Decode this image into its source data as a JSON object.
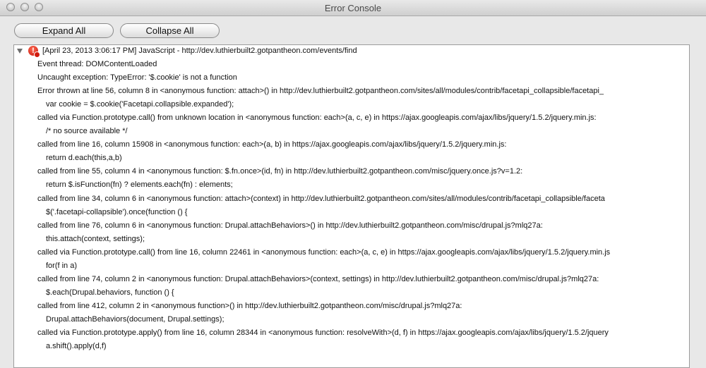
{
  "window": {
    "title": "Error Console"
  },
  "toolbar": {
    "expand_label": "Expand All",
    "collapse_label": "Collapse All"
  },
  "entry": {
    "header": "[April 23, 2013 3:06:17 PM] JavaScript - http://dev.luthierbuilt2.gotpantheon.com/events/find",
    "icon": "error-icon",
    "lines": [
      {
        "indent": 0,
        "text": "Event thread: DOMContentLoaded"
      },
      {
        "indent": 0,
        "text": "Uncaught exception: TypeError: '$.cookie' is not a function"
      },
      {
        "indent": 0,
        "text": "Error thrown at line 56, column 8 in <anonymous function: attach>() in http://dev.luthierbuilt2.gotpantheon.com/sites/all/modules/contrib/facetapi_collapsible/facetapi_"
      },
      {
        "indent": 1,
        "text": "var cookie = $.cookie('Facetapi.collapsible.expanded');"
      },
      {
        "indent": 0,
        "text": "called via Function.prototype.call() from unknown location in <anonymous function: each>(a, c, e) in https://ajax.googleapis.com/ajax/libs/jquery/1.5.2/jquery.min.js:"
      },
      {
        "indent": 1,
        "text": "/* no source available */"
      },
      {
        "indent": 0,
        "text": "called from line 16, column 15908 in <anonymous function: each>(a, b) in https://ajax.googleapis.com/ajax/libs/jquery/1.5.2/jquery.min.js:"
      },
      {
        "indent": 1,
        "text": "return d.each(this,a,b)"
      },
      {
        "indent": 0,
        "text": "called from line 55, column 4 in <anonymous function: $.fn.once>(id, fn) in http://dev.luthierbuilt2.gotpantheon.com/misc/jquery.once.js?v=1.2:"
      },
      {
        "indent": 1,
        "text": "return $.isFunction(fn) ? elements.each(fn) : elements;"
      },
      {
        "indent": 0,
        "text": "called from line 34, column 6 in <anonymous function: attach>(context) in http://dev.luthierbuilt2.gotpantheon.com/sites/all/modules/contrib/facetapi_collapsible/faceta"
      },
      {
        "indent": 1,
        "text": "$('.facetapi-collapsible').once(function () {"
      },
      {
        "indent": 0,
        "text": "called from line 76, column 6 in <anonymous function: Drupal.attachBehaviors>() in http://dev.luthierbuilt2.gotpantheon.com/misc/drupal.js?mlq27a:"
      },
      {
        "indent": 1,
        "text": "this.attach(context, settings);"
      },
      {
        "indent": 0,
        "text": "called via Function.prototype.call() from line 16, column 22461 in <anonymous function: each>(a, c, e) in https://ajax.googleapis.com/ajax/libs/jquery/1.5.2/jquery.min.js"
      },
      {
        "indent": 1,
        "text": "for(f in a)"
      },
      {
        "indent": 0,
        "text": "called from line 74, column 2 in <anonymous function: Drupal.attachBehaviors>(context, settings) in http://dev.luthierbuilt2.gotpantheon.com/misc/drupal.js?mlq27a:"
      },
      {
        "indent": 1,
        "text": "$.each(Drupal.behaviors, function () {"
      },
      {
        "indent": 0,
        "text": "called from line 412, column 2 in <anonymous function>() in http://dev.luthierbuilt2.gotpantheon.com/misc/drupal.js?mlq27a:"
      },
      {
        "indent": 1,
        "text": "Drupal.attachBehaviors(document, Drupal.settings);"
      },
      {
        "indent": 0,
        "text": "called via Function.prototype.apply() from line 16, column 28344 in <anonymous function: resolveWith>(d, f) in https://ajax.googleapis.com/ajax/libs/jquery/1.5.2/jquery"
      },
      {
        "indent": 1,
        "text": "a.shift().apply(d,f)"
      }
    ]
  }
}
